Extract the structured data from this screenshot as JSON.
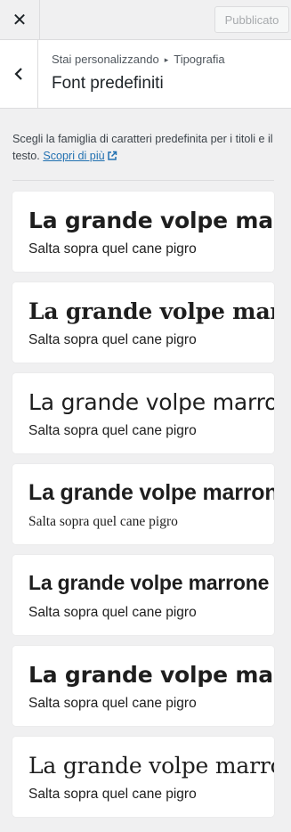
{
  "topbar": {
    "close_icon": "close-icon",
    "publish_label": "Pubblicato"
  },
  "section": {
    "back_icon": "chevron-left-icon",
    "breadcrumb_parent": "Stai personalizzando",
    "breadcrumb_current": "Tipografia",
    "title": "Font predefiniti"
  },
  "description": {
    "text": "Scegli la famiglia di caratteri predefinita per i titoli e il testo.",
    "link_label": "Scopri di più",
    "link_icon": "external-link-icon"
  },
  "font_presets": [
    {
      "heading": "La grande volpe marrone",
      "body": "Salta sopra quel cane pigro"
    },
    {
      "heading": "La grande volpe marrone",
      "body": "Salta sopra quel cane pigro"
    },
    {
      "heading": "La grande volpe marrone",
      "body": "Salta sopra quel cane pigro"
    },
    {
      "heading": "La grande volpe marrone",
      "body": "Salta sopra quel cane pigro"
    },
    {
      "heading": "La grande volpe marrone",
      "body": "Salta sopra quel cane pigro"
    },
    {
      "heading": "La grande volpe marrone",
      "body": "Salta sopra quel cane pigro"
    },
    {
      "heading": "La grande volpe marrone",
      "body": "Salta sopra quel cane pigro"
    }
  ],
  "colors": {
    "link": "#2271b1",
    "panel_bg": "#f0f0f1",
    "card_bg": "#ffffff"
  }
}
